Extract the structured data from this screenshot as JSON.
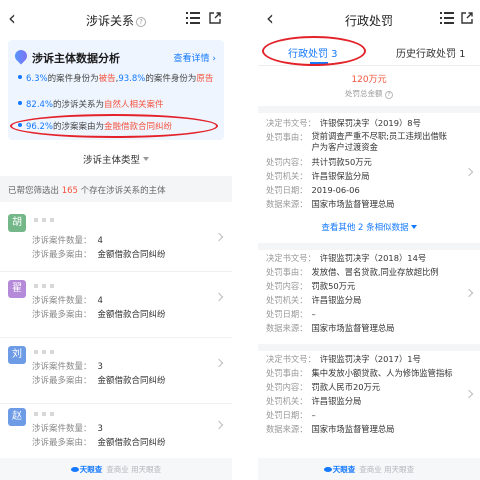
{
  "left": {
    "title": "涉诉关系",
    "card": {
      "title": "涉诉主体数据分析",
      "detail_link": "查看详情",
      "stats": [
        {
          "pct1": "6.3%",
          "t1": "的案件身份为",
          "role1": "被告",
          "sep": ",",
          "pct2": "93.8%",
          "t2": "的案件身份为",
          "role2": "原告"
        },
        {
          "pct1": "82.4%",
          "t1": "的涉诉关系为",
          "role1": "自然人相关案件"
        },
        {
          "pct1": "96.2%",
          "t1": "的涉案案由为",
          "role1": "金融借款合同纠纷"
        }
      ]
    },
    "sort_label": "涉诉主体类型",
    "filter": {
      "prefix": "已帮您筛选出",
      "count": "165",
      "suffix": "个存在涉诉关系的主体"
    },
    "entities": [
      {
        "surname": "胡",
        "color": "#74b88a",
        "count_label": "涉诉案件数量：",
        "count": "4",
        "cause_label": "涉诉最多案由：",
        "cause": "金额借款合同纠纷"
      },
      {
        "surname": "翟",
        "color": "#b58ad9",
        "count_label": "涉诉案件数量：",
        "count": "4",
        "cause_label": "涉诉最多案由：",
        "cause": "金额借款合同纠纷"
      },
      {
        "surname": "刘",
        "color": "#6e9be6",
        "count_label": "涉诉案件数量：",
        "count": "3",
        "cause_label": "涉诉最多案由：",
        "cause": "金额借款合同纠纷"
      },
      {
        "surname": "赵",
        "color": "#6e9be6",
        "count_label": "涉诉案件数量：",
        "count": "3",
        "cause_label": "涉诉最多案由：",
        "cause": "金额借款合同纠纷"
      }
    ],
    "footer": {
      "logo": "天眼查",
      "text": "查商业 用天眼查"
    }
  },
  "right": {
    "title": "行政处罚",
    "tabs": [
      {
        "label": "行政处罚 3",
        "active": true
      },
      {
        "label": "历史行政处罚 1",
        "active": false
      }
    ],
    "total_amount": "120万元",
    "total_label": "处罚总金额",
    "labels": {
      "doc": "决定书文号：",
      "reason": "处罚事由：",
      "content": "处罚内容：",
      "authority": "处罚机关：",
      "date": "处罚日期：",
      "source": "数据来源："
    },
    "penalties": [
      {
        "doc": "许银保罚决字（2019）8号",
        "reason": "贷前调查严重不尽职;员工违规出借账户为客户过渡资金",
        "content": "共计罚款50万元",
        "authority": "许昌银保监分局",
        "date": "2019-06-06",
        "source": "国家市场监督管理总局"
      },
      {
        "doc": "许银监罚决字（2018）14号",
        "reason": "发放借、冒名贷款,同业存放超比例",
        "content": "罚款50万元",
        "authority": "许昌银监分局",
        "date": "–",
        "source": "国家市场监督管理总局"
      },
      {
        "doc": "许银监罚决字（2017）1号",
        "reason": "集中发放小额贷款、人为修饰监管指标",
        "content": "罚款人民币20万元",
        "authority": "许昌银监分局",
        "date": "–",
        "source": "国家市场监督管理总局"
      }
    ],
    "more_link": "查看其他 2 条相似数据",
    "footer": {
      "logo": "天眼查",
      "text": "查商业 用天眼查"
    },
    "accent_color": "#1479ff",
    "highlight_color": "#e4222a"
  }
}
